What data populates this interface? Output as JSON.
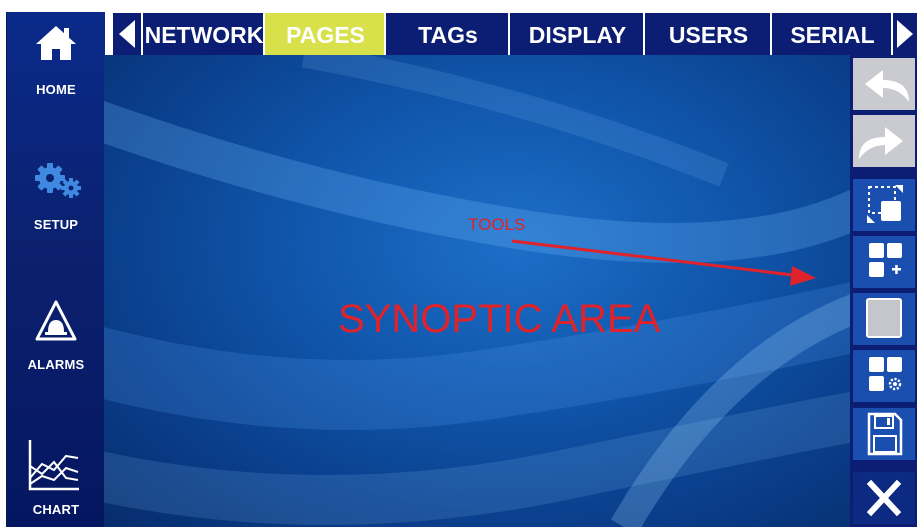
{
  "sidebar": {
    "items": [
      {
        "label": "HOME",
        "icon": "home-icon"
      },
      {
        "label": "SETUP",
        "icon": "gears-icon"
      },
      {
        "label": "ALARMS",
        "icon": "alarm-icon"
      },
      {
        "label": "CHART",
        "icon": "chart-icon"
      }
    ]
  },
  "tabs": {
    "items": [
      {
        "label": "NETWORK"
      },
      {
        "label": "PAGES",
        "active": true
      },
      {
        "label": "TAGs"
      },
      {
        "label": "DISPLAY"
      },
      {
        "label": "USERS"
      },
      {
        "label": "SERIAL"
      }
    ],
    "prev_icon": "triangle-left-icon",
    "next_icon": "triangle-right-icon"
  },
  "toolbar": {
    "items": [
      {
        "icon": "undo-icon",
        "state": "disabled"
      },
      {
        "icon": "redo-icon",
        "state": "disabled"
      },
      {
        "icon": "select-resize-icon",
        "state": "enabled"
      },
      {
        "icon": "add-widget-icon",
        "state": "enabled"
      },
      {
        "icon": "blank-page-icon",
        "state": "enabled"
      },
      {
        "icon": "widget-settings-icon",
        "state": "enabled"
      },
      {
        "icon": "save-icon",
        "state": "enabled"
      },
      {
        "icon": "close-icon",
        "state": "enabled"
      }
    ]
  },
  "annotations": {
    "tools": "TOOLS",
    "synoptic": "SYNOPTIC AREA"
  },
  "colors": {
    "nav_bg": "#0b1e73",
    "active_tab": "#d8e04a",
    "annotation": "#e0222a",
    "main_bg": "#1158ae"
  }
}
